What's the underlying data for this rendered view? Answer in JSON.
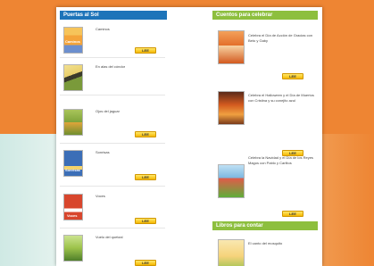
{
  "sections": {
    "left_header": "Puertas al Sol",
    "right_header": "Cuentos para celebrar",
    "right_header2": "Libros para contar"
  },
  "left_items": [
    {
      "title": "Caminos",
      "cover_text": "Caminos",
      "cover_color": "#f4a43a"
    },
    {
      "title": "En alas del cóndor",
      "cover_color": "#e9cf6a"
    },
    {
      "title": "Ojos del jaguar",
      "cover_color": "#7ea33a"
    },
    {
      "title": "Sonrisas",
      "cover_text": "Sonrisas",
      "cover_color": "#3b6eb7"
    },
    {
      "title": "Voces",
      "cover_text": "Voces",
      "cover_color": "#d8462d"
    },
    {
      "title": "Vuelo del quetzal",
      "cover_color": "#9cc24a"
    }
  ],
  "right_items": [
    {
      "title": "Celebra el Día de Acción de Gracias con Beto y Gaby",
      "cover_color": "#e36f2a"
    },
    {
      "title": "Celebra el Halloween y el Día de Muertos con Cristina y su conejito azul",
      "cover_color": "#d35a1f"
    },
    {
      "title": "Celebra la Navidad y el Día de los Reyes Magos con Pablo y Carlitos",
      "cover_color": "#7cb7e0"
    },
    {
      "title": "El canto del mosquito",
      "cover_color": "#f6d37b"
    }
  ],
  "buttons": {
    "read_label": "LEE"
  }
}
